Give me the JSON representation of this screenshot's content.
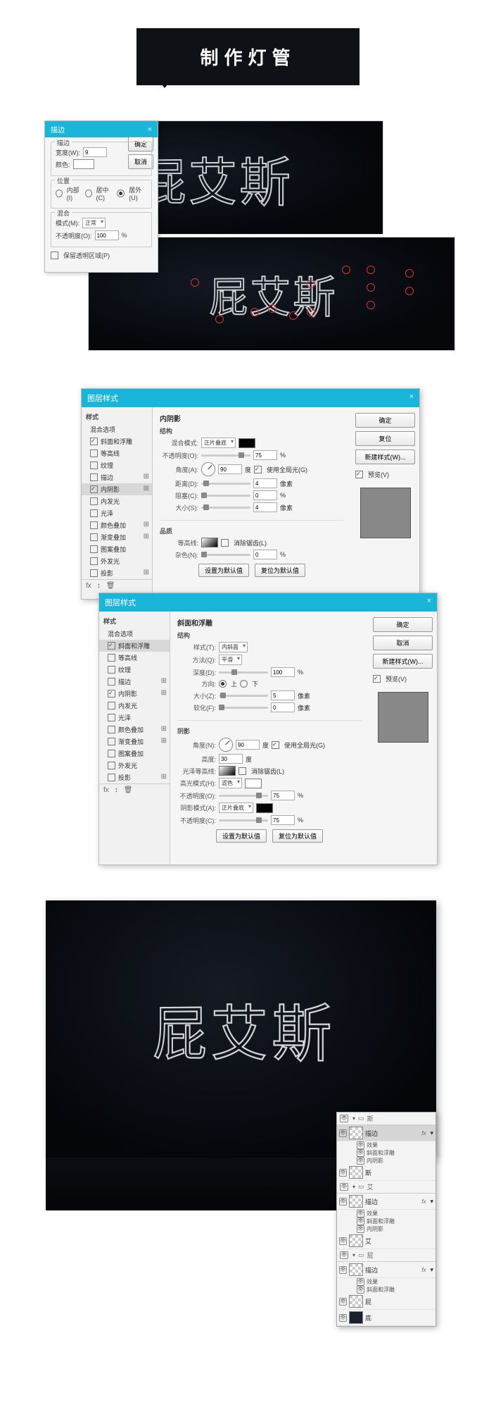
{
  "banner": "制作灯管",
  "neon_word": "屁艾斯",
  "stroke_dlg": {
    "title": "描边",
    "ok": "确定",
    "cancel": "取消",
    "fs_stroke": "描边",
    "width_label": "宽度(W):",
    "width_val": "9",
    "color_label": "颜色:",
    "fs_pos": "位置",
    "pos_inside": "内部(I)",
    "pos_center": "居中(C)",
    "pos_outside": "居外(U)",
    "fs_blend": "混合",
    "mode_label": "模式(M):",
    "mode_val": "正常",
    "opacity_label": "不透明度(O):",
    "opacity_val": "100",
    "pct": "%",
    "preserve": "保留透明区域(P)"
  },
  "ls_title": "图层样式",
  "ls_side": {
    "cat": "样式",
    "blend": "混合选项",
    "items": [
      "斜面和浮雕",
      "等高线",
      "纹理",
      "描边",
      "内阴影",
      "内发光",
      "光泽",
      "颜色叠加",
      "渐变叠加",
      "图案叠加",
      "外发光",
      "投影"
    ]
  },
  "ls_right": {
    "ok": "确定",
    "reset": "复位",
    "cancel": "取消",
    "newstyle": "新建样式(W)...",
    "preview": "预览(V)"
  },
  "inner_shadow": {
    "heading": "内阴影",
    "struct": "结构",
    "blend": "混合模式:",
    "blend_val": "正片叠底",
    "opacity": "不透明度(O):",
    "opacity_val": "75",
    "pct": "%",
    "angle": "角度(A):",
    "angle_val": "90",
    "deg": "度",
    "global": "使用全局光(G)",
    "distance": "距离(D):",
    "distance_val": "4",
    "px": "像素",
    "choke": "阻塞(C):",
    "choke_val": "0",
    "size": "大小(S):",
    "size_val": "4",
    "quality": "品质",
    "contour": "等高线:",
    "anti": "消除锯齿(L)",
    "noise": "杂色(N):",
    "noise_val": "0",
    "btn_default": "设置为默认值",
    "btn_reset": "复位为默认值"
  },
  "bevel": {
    "heading": "斜面和浮雕",
    "struct": "结构",
    "style": "样式(T):",
    "style_val": "内斜面",
    "tech": "方法(Q):",
    "tech_val": "平滑",
    "depth": "深度(D):",
    "depth_val": "100",
    "pct": "%",
    "dir": "方向:",
    "up": "上",
    "down": "下",
    "size": "大小(Z):",
    "size_val": "5",
    "px": "像素",
    "soften": "软化(F):",
    "soften_val": "0",
    "shade": "阴影",
    "angle": "角度(N):",
    "angle_val": "90",
    "deg": "度",
    "global": "使用全局光(G)",
    "alt": "高度:",
    "alt_val": "30",
    "gloss": "光泽等高线:",
    "anti": "消除锯齿(L)",
    "hmode": "高光模式(H):",
    "hmode_val": "滤色",
    "hop": "不透明度(O):",
    "hop_val": "75",
    "smode": "阴影模式(A):",
    "smode_val": "正片叠底",
    "sop": "不透明度(C):",
    "sop_val": "75",
    "btn_default": "设置为默认值",
    "btn_reset": "复位为默认值"
  },
  "layers": {
    "grp_si": "斯",
    "l_stroke": "描边",
    "l_fx": "效果",
    "l_bevel": "斜面和浮雕",
    "l_inner": "内阴影",
    "l_si": "斯",
    "grp_ai": "艾",
    "l_ai": "艾",
    "grp_pi": "屁",
    "l_pi": "屁",
    "l_bg": "底"
  },
  "fx_label": "fx"
}
